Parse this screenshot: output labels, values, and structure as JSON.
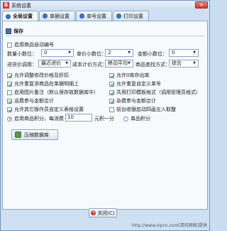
{
  "window": {
    "title": "系统设置",
    "close_label": "×",
    "app_icon": "系"
  },
  "tabs": [
    {
      "label": "全局设置"
    },
    {
      "label": "单据设置"
    },
    {
      "label": "单号设置"
    },
    {
      "label": "打印设置"
    }
  ],
  "save_label": "保存",
  "options": {
    "enable_auto_code": "启用商品自动编号",
    "qty_decimals_label": "数量小数位：",
    "qty_decimals_value": "0",
    "price_decimals_label": "单价小数位：",
    "price_decimals_value": "2",
    "amount_decimals_label": "金额小数位：",
    "amount_decimals_value": "0",
    "purchase_price_label": "进货价调用：",
    "purchase_price_value": "最近进价",
    "cost_method_label": "成本计价方式：",
    "cost_method_value": "移动平均",
    "product_search_label": "商品查找方式：",
    "product_search_value": "综合"
  },
  "left_checks": [
    {
      "label": "允许调整修改价格及折扣",
      "checked": true
    },
    {
      "label": "允许重复添商品在单据明细上",
      "checked": true
    },
    {
      "label": "启用图片备注（默认保存故数据库中）",
      "checked": false
    },
    {
      "label": "运费参与金额合计",
      "checked": true
    },
    {
      "label": "允许其它操作员自定义表格设置",
      "checked": true
    }
  ],
  "right_checks": [
    {
      "label": "允许0库存出库",
      "checked": true
    },
    {
      "label": "允许重复自定义单号",
      "checked": true
    },
    {
      "label": "共用打印模板格式（调用管理员格式）",
      "checked": true
    },
    {
      "label": "杂费参与金额合计",
      "checked": true
    },
    {
      "label": "前台收银启动四画五入取整",
      "checked": false
    }
  ],
  "points": {
    "enable_label": "启用商品积分，每消费",
    "amount_value": "10",
    "unit_label": "元积一分",
    "single_label": "单品积分"
  },
  "compress_label": "压缩数据库",
  "close_label": "关闭(C)",
  "watermark": "http://www.vipcn.com[清风网络]提供"
}
